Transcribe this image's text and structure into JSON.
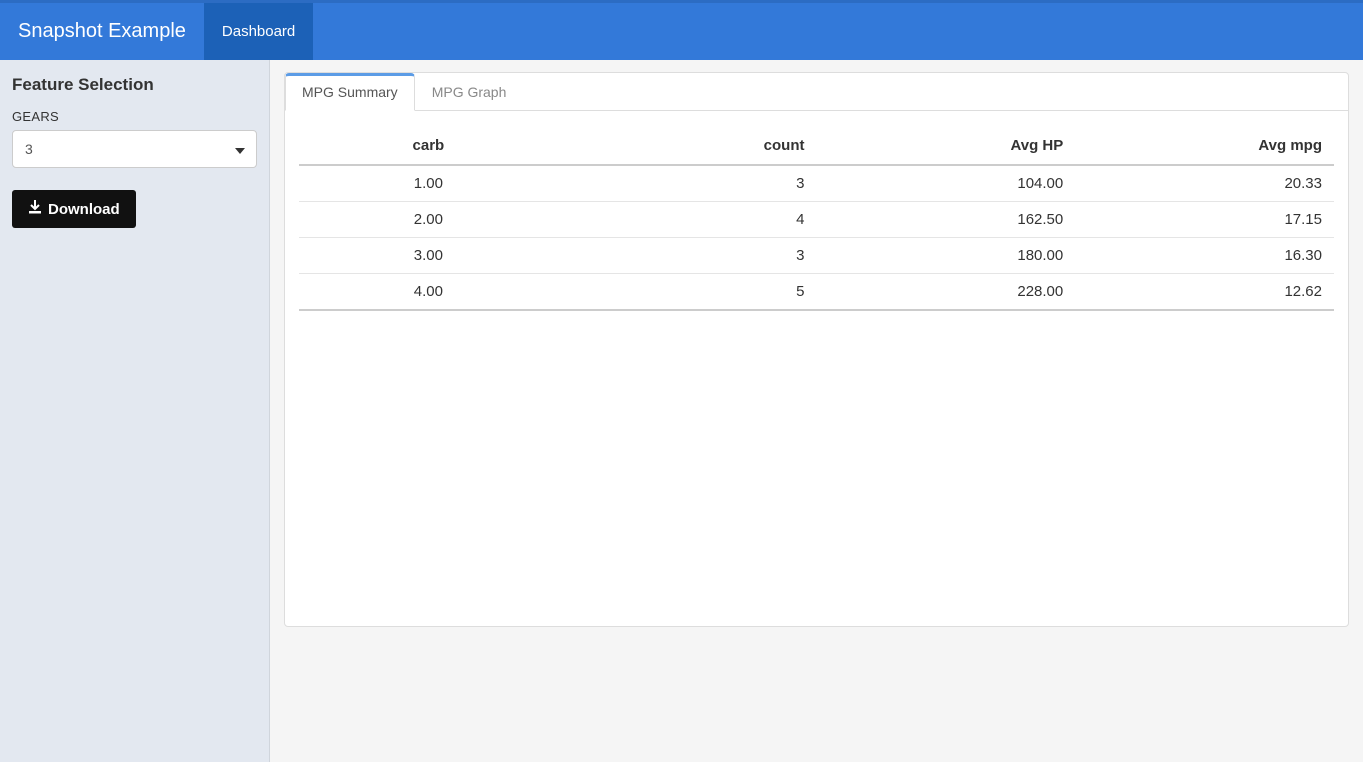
{
  "navbar": {
    "brand": "Snapshot Example",
    "items": [
      {
        "label": "Dashboard",
        "active": true
      }
    ]
  },
  "sidebar": {
    "heading": "Feature Selection",
    "gears_label": "GEARS",
    "gears_value": "3",
    "download_label": "Download"
  },
  "tabs": [
    {
      "label": "MPG Summary",
      "active": true
    },
    {
      "label": "MPG Graph",
      "active": false
    }
  ],
  "table": {
    "headers": [
      "carb",
      "count",
      "Avg HP",
      "Avg mpg"
    ],
    "rows": [
      [
        "1.00",
        "3",
        "104.00",
        "20.33"
      ],
      [
        "2.00",
        "4",
        "162.50",
        "17.15"
      ],
      [
        "3.00",
        "3",
        "180.00",
        "16.30"
      ],
      [
        "4.00",
        "5",
        "228.00",
        "12.62"
      ]
    ]
  }
}
